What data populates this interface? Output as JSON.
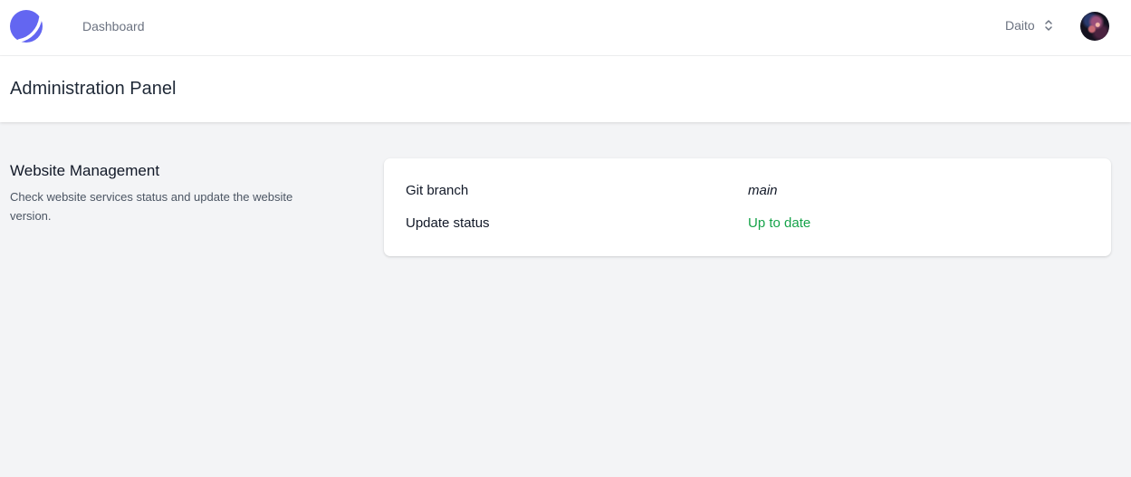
{
  "nav": {
    "logo_icon": "crescent-logo-icon",
    "links": [
      {
        "label": "Dashboard"
      }
    ],
    "user": {
      "name": "Daito",
      "switch_icon": "chevron-up-down-icon",
      "avatar": "user-avatar"
    }
  },
  "header": {
    "title": "Administration Panel"
  },
  "section": {
    "title": "Website Management",
    "description": "Check website services status and update the website version."
  },
  "card": {
    "rows": [
      {
        "label": "Git branch",
        "value": "main"
      },
      {
        "label": "Update status",
        "value": "Up to date"
      }
    ]
  },
  "colors": {
    "brand": "#6366f1",
    "success": "#16a34a",
    "background": "#f3f4f6"
  }
}
